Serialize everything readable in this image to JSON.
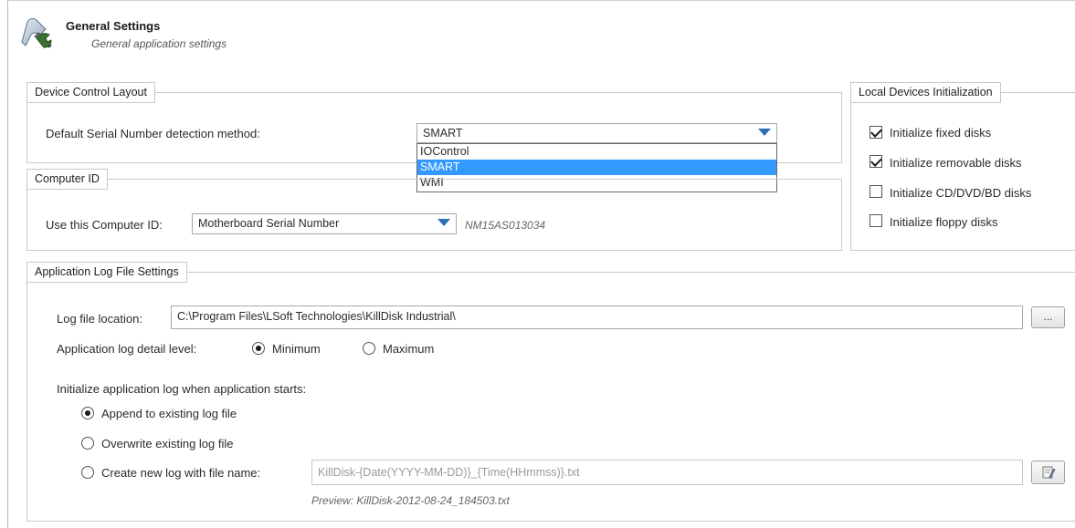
{
  "header": {
    "title": "General Settings",
    "subtitle": "General application settings",
    "icon": "settings-wrench-icon"
  },
  "device_control": {
    "legend": "Device Control Layout",
    "serial_label": "Default Serial Number detection method:",
    "serial_value": "SMART",
    "serial_options": [
      "IOControl",
      "SMART",
      "WMI"
    ],
    "serial_selected": "SMART"
  },
  "computer_id": {
    "legend": "Computer ID",
    "label": "Use this Computer ID:",
    "value": "Motherboard Serial Number",
    "serial_readout": "NM15AS013034"
  },
  "local_devices": {
    "legend": "Local Devices Initialization",
    "items": [
      {
        "label": "Initialize fixed disks",
        "checked": true
      },
      {
        "label": "Initialize removable disks",
        "checked": true
      },
      {
        "label": "Initialize CD/DVD/BD disks",
        "checked": false
      },
      {
        "label": "Initialize floppy disks",
        "checked": false
      }
    ]
  },
  "log_settings": {
    "legend": "Application Log File Settings",
    "location_label": "Log file location:",
    "location_value": "C:\\Program Files\\LSoft Technologies\\KillDisk Industrial\\",
    "browse_label": "...",
    "detail_label": "Application log detail level:",
    "detail_min": "Minimum",
    "detail_max": "Maximum",
    "detail_selected": "Minimum",
    "init_label": "Initialize application log when application starts:",
    "init_options": [
      {
        "label": "Append to existing log file",
        "selected": true
      },
      {
        "label": "Overwrite existing log file",
        "selected": false
      },
      {
        "label": "Create new log with file name:",
        "selected": false
      }
    ],
    "filename_value": "KillDisk-{Date(YYYY-MM-DD)}_{Time(HHmmss)}.txt",
    "preview": "Preview: KillDisk-2012-08-24_184503.txt",
    "edit_icon": "edit-pattern-icon"
  },
  "colors": {
    "accent": "#2f6fb4",
    "selection": "#3399ff",
    "border": "#c8c8c8"
  }
}
